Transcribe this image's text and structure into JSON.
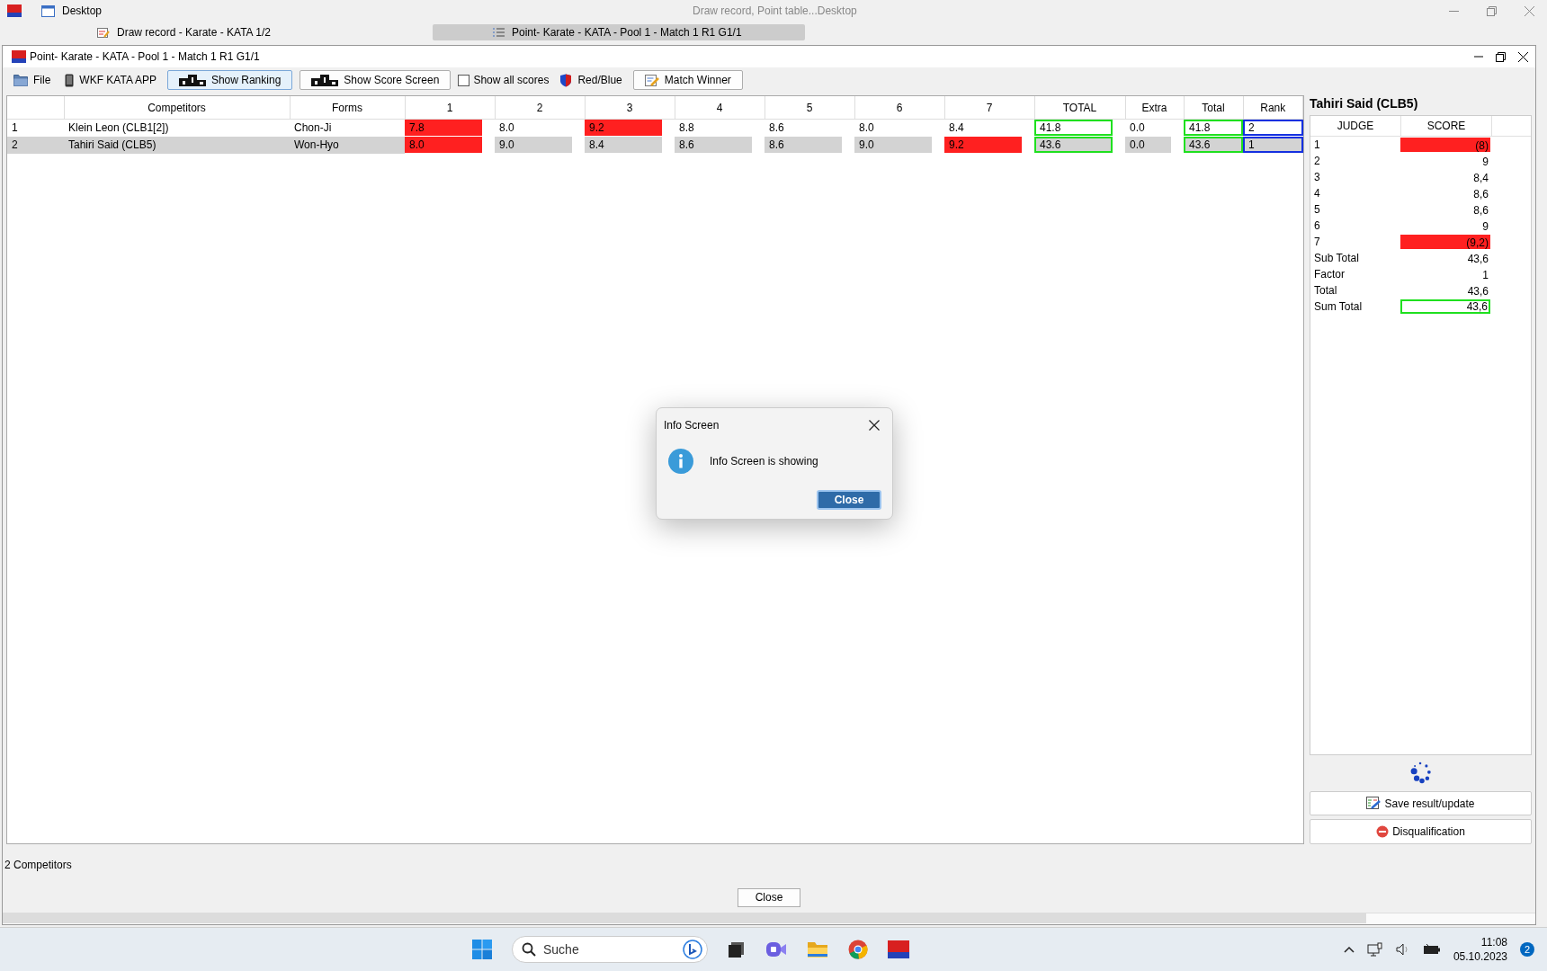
{
  "desktop_bar": {
    "title": "Desktop",
    "caption": "Draw record, Point table...Desktop"
  },
  "window_tabs": [
    {
      "label": "Draw record - Karate - KATA 1/2",
      "selected": false
    },
    {
      "label": "Point- Karate - KATA - Pool 1 - Match 1 R1 G1/1",
      "selected": true
    }
  ],
  "window": {
    "title": "Point- Karate - KATA - Pool 1 - Match 1 R1 G1/1"
  },
  "toolbar": [
    {
      "kind": "menu",
      "label": "File"
    },
    {
      "kind": "menu",
      "label": "WKF KATA APP"
    },
    {
      "kind": "button",
      "label": "Show Ranking",
      "pressed": true
    },
    {
      "kind": "button",
      "label": "Show Score Screen",
      "pressed": false
    },
    {
      "kind": "checkbox",
      "label": "Show all scores",
      "checked": false
    },
    {
      "kind": "menu",
      "label": "Red/Blue"
    },
    {
      "kind": "button",
      "label": "Match Winner",
      "pressed": false
    }
  ],
  "table": {
    "columns": [
      "Competitors",
      "Forms",
      "1",
      "2",
      "3",
      "4",
      "5",
      "6",
      "7",
      "TOTAL",
      "Extra",
      "Total",
      "Rank"
    ],
    "rows": [
      {
        "no": "1",
        "competitor": "Klein Leon (CLB1[2])",
        "form": "Chon-Ji",
        "selected": false,
        "scores": [
          {
            "value": "7.8",
            "discarded": true
          },
          {
            "value": "8.0",
            "discarded": false
          },
          {
            "value": "9.2",
            "discarded": true
          },
          {
            "value": "8.8",
            "discarded": false
          },
          {
            "value": "8.6",
            "discarded": false
          },
          {
            "value": "8.0",
            "discarded": false
          },
          {
            "value": "8.4",
            "discarded": false
          }
        ],
        "total": "41.8",
        "extra": "0.0",
        "sum_total": "41.8",
        "rank": "2"
      },
      {
        "no": "2",
        "competitor": "Tahiri Said (CLB5)",
        "form": "Won-Hyo",
        "selected": true,
        "scores": [
          {
            "value": "8.0",
            "discarded": true
          },
          {
            "value": "9.0",
            "discarded": false
          },
          {
            "value": "8.4",
            "discarded": false
          },
          {
            "value": "8.6",
            "discarded": false
          },
          {
            "value": "8.6",
            "discarded": false
          },
          {
            "value": "9.0",
            "discarded": false
          },
          {
            "value": "9.2",
            "discarded": true
          }
        ],
        "total": "43.6",
        "extra": "0.0",
        "sum_total": "43.6",
        "rank": "1"
      }
    ]
  },
  "side_panel": {
    "title": "Tahiri Said (CLB5)",
    "columns": [
      "JUDGE",
      "SCORE"
    ],
    "judges": [
      {
        "judge": "1",
        "score": "(8)",
        "discarded": true
      },
      {
        "judge": "2",
        "score": "9",
        "discarded": false
      },
      {
        "judge": "3",
        "score": "8,4",
        "discarded": false
      },
      {
        "judge": "4",
        "score": "8,6",
        "discarded": false
      },
      {
        "judge": "5",
        "score": "8,6",
        "discarded": false
      },
      {
        "judge": "6",
        "score": "9",
        "discarded": false
      },
      {
        "judge": "7",
        "score": "(9,2)",
        "discarded": true
      }
    ],
    "summary": [
      {
        "label": "Sub Total",
        "value": "43,6",
        "highlighted": false
      },
      {
        "label": "Factor",
        "value": "1",
        "highlighted": false
      },
      {
        "label": "Total",
        "value": "43,6",
        "highlighted": false
      },
      {
        "label": "Sum Total",
        "value": "43,6",
        "highlighted": true
      }
    ],
    "buttons": [
      {
        "kind": "save",
        "label": "Save result/update"
      },
      {
        "kind": "disqualify",
        "label": "Disqualification"
      }
    ]
  },
  "status": "2 Competitors",
  "close_button": "Close",
  "dialog": {
    "title": "Info Screen",
    "message": "Info Screen is showing",
    "button": "Close"
  },
  "taskbar": {
    "search_placeholder": "Suche",
    "time": "11:08",
    "date": "05.10.2023",
    "notifications": "2"
  }
}
